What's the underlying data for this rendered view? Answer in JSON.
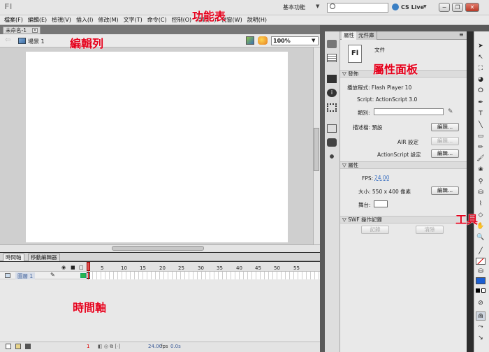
{
  "app": {
    "logo": "Fl"
  },
  "titlebar": {
    "workspace": "基本功能",
    "search_placeholder": "",
    "cs_live": "CS Live"
  },
  "window_controls": {
    "minimize": "−",
    "restore": "❐",
    "close": "✕"
  },
  "menu": [
    "檔案(F)",
    "編輯(E)",
    "檢視(V)",
    "插入(I)",
    "修改(M)",
    "文字(T)",
    "命令(C)",
    "控制(O)",
    "除錯(D)",
    "視窗(W)",
    "說明(H)"
  ],
  "document": {
    "tab": "未命名-1",
    "tab_close": "×"
  },
  "editbar": {
    "back": "⇦",
    "scene": "場景 1",
    "zoom": "100%"
  },
  "timeline": {
    "tabs": [
      "時間軸",
      "移動編輯器"
    ],
    "frame_numbers": [
      "1",
      "5",
      "10",
      "15",
      "20",
      "25",
      "30",
      "35",
      "40",
      "45",
      "50",
      "55"
    ],
    "layer": "圖層 1",
    "status": {
      "frame": "1",
      "fps": "24.00",
      "fps_unit": "fps",
      "time": "0.0s"
    }
  },
  "panel": {
    "tabs": [
      "屬性",
      "元件庫"
    ],
    "doc_badge": "Fl",
    "doc_type": "文件",
    "publish": {
      "header": "發佈",
      "player": "播放程式: Flash Player 10",
      "script": "Script: ActionScript 3.0",
      "class_label": "類別:",
      "profile": "描述檔: 預設",
      "edit": "編輯...",
      "air": "AIR 設定",
      "air_edit": "編輯...",
      "as": "ActionScript 設定",
      "as_edit": "編輯..."
    },
    "properties": {
      "header": "屬性",
      "fps_label": "FPS:",
      "fps": "24.00",
      "size": "大小: 550 x 400 像素",
      "size_edit": "編輯...",
      "stage_label": "舞台:"
    },
    "swf": {
      "header": "SWF 操作記錄",
      "log": "記錄",
      "clear": "清除"
    }
  },
  "annotations": {
    "menubar": "功能表",
    "editbar": "編輯列",
    "panel": "屬性面板",
    "tools": "工具",
    "timeline": "時間軸"
  }
}
